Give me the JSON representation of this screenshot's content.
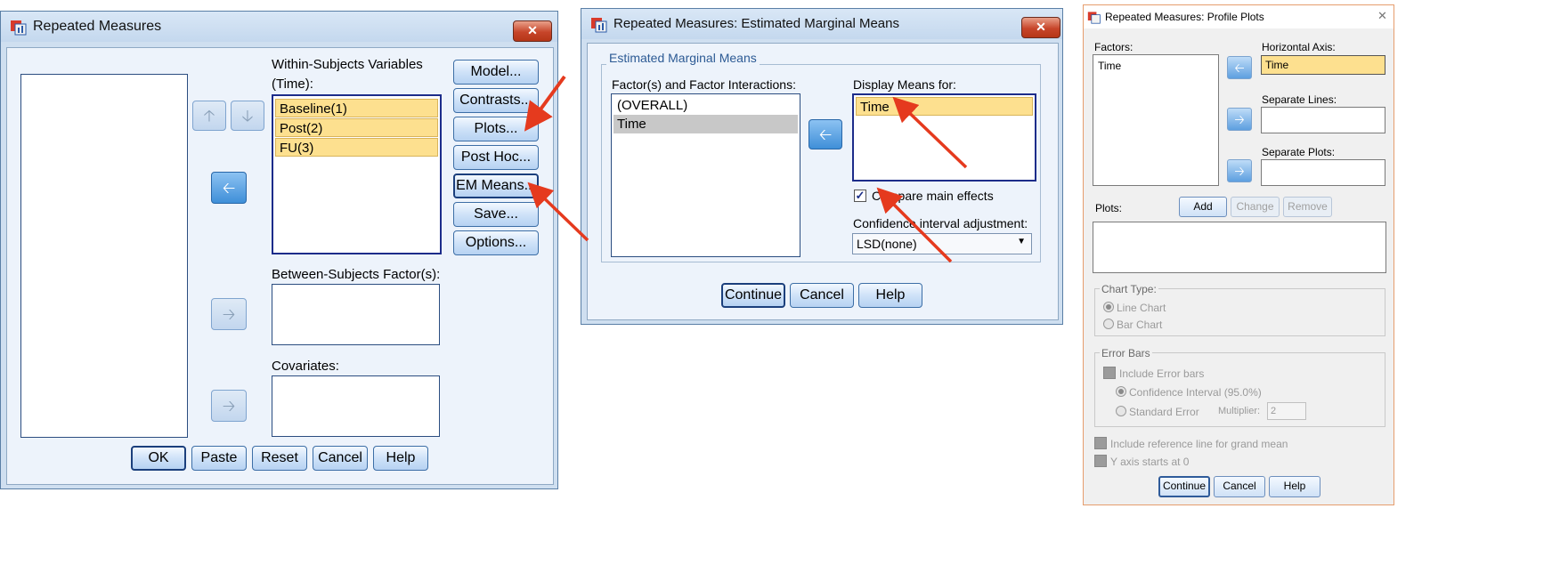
{
  "dialog1": {
    "title": "Repeated Measures",
    "close_label": "✕",
    "within_label_line1": "Within-Subjects Variables",
    "within_label_line2": "(Time):",
    "within_items": [
      "Baseline(1)",
      "Post(2)",
      "FU(3)"
    ],
    "between_label": "Between-Subjects Factor(s):",
    "covariates_label": "Covariates:",
    "side_buttons": [
      "Model...",
      "Contrasts...",
      "Plots...",
      "Post Hoc...",
      "EM Means...",
      "Save...",
      "Options..."
    ],
    "bottom_buttons": [
      "OK",
      "Paste",
      "Reset",
      "Cancel",
      "Help"
    ]
  },
  "dialog2": {
    "title": "Repeated Measures: Estimated Marginal Means",
    "close_label": "✕",
    "group_title": "Estimated Marginal Means",
    "factor_label": "Factor(s) and Factor Interactions:",
    "factor_items": [
      "(OVERALL)",
      "Time"
    ],
    "display_label": "Display Means for:",
    "display_items": [
      "Time"
    ],
    "compare_label": "Compare main effects",
    "compare_checked": true,
    "ci_label": "Confidence interval adjustment:",
    "ci_value": "LSD(none)",
    "bottom_buttons": [
      "Continue",
      "Cancel",
      "Help"
    ]
  },
  "dialog3": {
    "title": "Repeated Measures: Profile Plots",
    "close_label": "✕",
    "factors_label": "Factors:",
    "factor_items": [
      "Time"
    ],
    "horizontal_label": "Horizontal Axis:",
    "horizontal_value": "Time",
    "separate_lines_label": "Separate Lines:",
    "separate_plots_label": "Separate Plots:",
    "plots_label": "Plots:",
    "add_label": "Add",
    "change_label": "Change",
    "remove_label": "Remove",
    "chart_type_title": "Chart Type:",
    "line_chart_label": "Line Chart",
    "bar_chart_label": "Bar Chart",
    "error_bars_title": "Error Bars",
    "include_error_label": "Include Error bars",
    "ci_label": "Confidence Interval (95.0%)",
    "se_label": "Standard Error",
    "multiplier_label": "Multiplier:",
    "multiplier_value": "2",
    "ref_line_label": "Include reference line for grand mean",
    "y_axis_label": "Y axis starts at 0",
    "bottom_buttons": [
      "Continue",
      "Cancel",
      "Help"
    ]
  },
  "colors": {
    "highlight": "#fde08f",
    "annotation_arrow": "#e53a1e",
    "active_arrow": "#3f8fd8"
  }
}
